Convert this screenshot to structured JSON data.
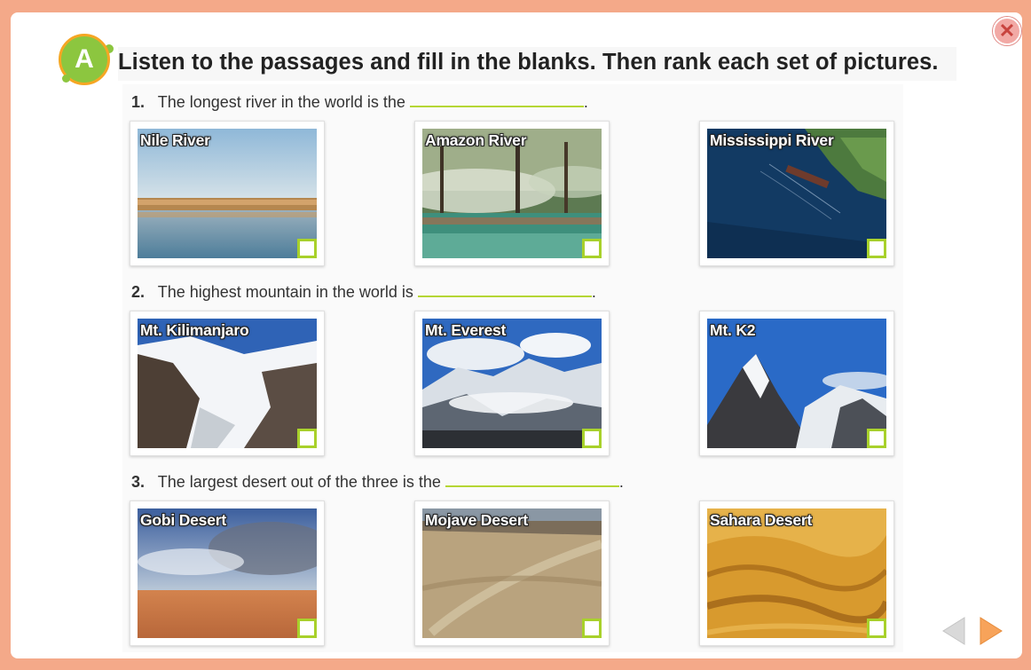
{
  "header": {
    "badge_letter": "A",
    "instruction": "Listen to the passages and fill in the blanks. Then rank each set of pictures."
  },
  "questions": [
    {
      "number": "1",
      "before": "The longest river in the world is the",
      "after": ".",
      "cards": [
        {
          "label": "Nile River"
        },
        {
          "label": "Amazon River"
        },
        {
          "label": "Mississippi River"
        }
      ]
    },
    {
      "number": "2",
      "before": "The highest mountain in the world is",
      "after": ".",
      "cards": [
        {
          "label": "Mt. Kilimanjaro"
        },
        {
          "label": "Mt. Everest"
        },
        {
          "label": "Mt. K2"
        }
      ]
    },
    {
      "number": "3",
      "before": "The largest desert out of the three is the",
      "after": ".",
      "cards": [
        {
          "label": "Gobi Desert"
        },
        {
          "label": "Mojave Desert"
        },
        {
          "label": "Sahara Desert"
        }
      ]
    }
  ],
  "controls": {
    "close_icon": "close-icon",
    "prev_icon": "arrow-left-icon",
    "next_icon": "arrow-right-icon",
    "prev_enabled": false,
    "next_enabled": true
  },
  "colors": {
    "background": "#f4a989",
    "accent_green": "#a8d12b",
    "badge_green": "#8cc63f",
    "badge_ring": "#f6a623",
    "next_arrow": "#f59a4a",
    "prev_arrow": "#cccccc"
  }
}
